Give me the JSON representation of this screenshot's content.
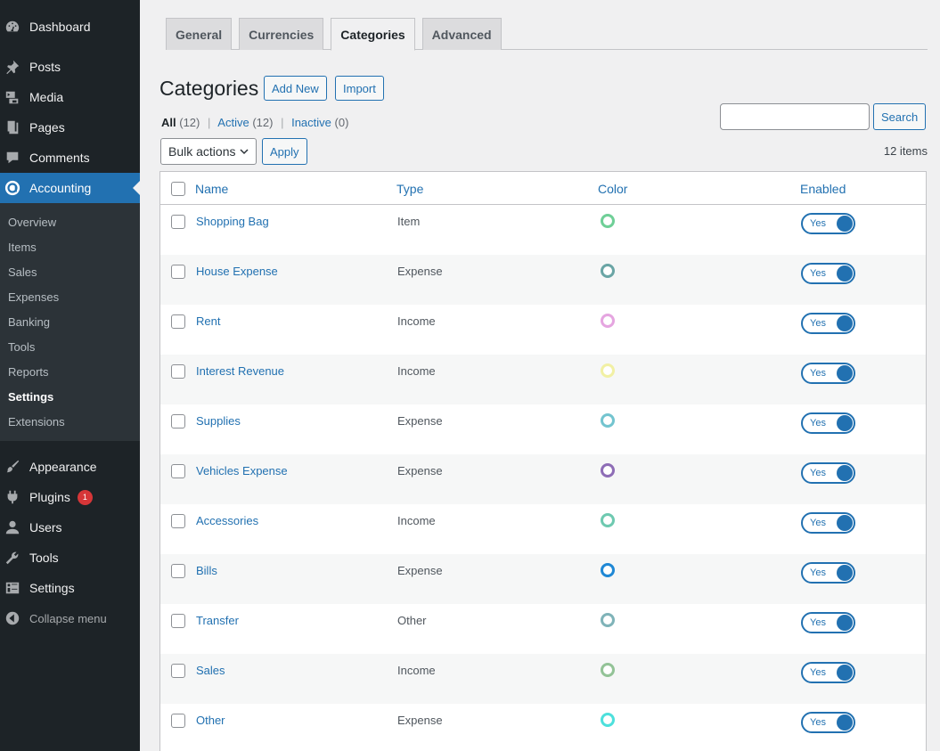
{
  "sidebar": {
    "top_items": [
      {
        "label": "Dashboard",
        "icon": "dashboard-icon"
      },
      {
        "label": "Posts",
        "icon": "pin-icon"
      },
      {
        "label": "Media",
        "icon": "media-icon"
      },
      {
        "label": "Pages",
        "icon": "pages-icon"
      },
      {
        "label": "Comments",
        "icon": "comment-icon"
      },
      {
        "label": "Accounting",
        "icon": "accounting-icon"
      }
    ],
    "submenu": [
      "Overview",
      "Items",
      "Sales",
      "Expenses",
      "Banking",
      "Tools",
      "Reports",
      "Settings",
      "Extensions"
    ],
    "bottom_items": [
      {
        "label": "Appearance",
        "icon": "brush-icon"
      },
      {
        "label": "Plugins",
        "icon": "plugin-icon",
        "badge": "1"
      },
      {
        "label": "Users",
        "icon": "user-icon"
      },
      {
        "label": "Tools",
        "icon": "wrench-icon"
      },
      {
        "label": "Settings",
        "icon": "settings-icon"
      },
      {
        "label": "Collapse menu",
        "icon": "collapse-icon"
      }
    ]
  },
  "tabs": [
    "General",
    "Currencies",
    "Categories",
    "Advanced"
  ],
  "header": {
    "title": "Categories",
    "add_new": "Add New",
    "import": "Import"
  },
  "filters": {
    "all_label": "All",
    "all_count": "(12)",
    "active_label": "Active",
    "active_count": "(12)",
    "inactive_label": "Inactive",
    "inactive_count": "(0)"
  },
  "search": {
    "button": "Search",
    "value": ""
  },
  "bulk": {
    "select": "Bulk actions",
    "apply": "Apply"
  },
  "items_count": "12 items",
  "table": {
    "columns": [
      "Name",
      "Type",
      "Color",
      "Enabled"
    ],
    "rows": [
      {
        "name": "Shopping Bag",
        "type": "Item",
        "color": "#6fcf97",
        "enabled": "Yes"
      },
      {
        "name": "House Expense",
        "type": "Expense",
        "color": "#6aa5a5",
        "enabled": "Yes"
      },
      {
        "name": "Rent",
        "type": "Income",
        "color": "#e5a5e0",
        "enabled": "Yes"
      },
      {
        "name": "Interest Revenue",
        "type": "Income",
        "color": "#f1f0a4",
        "enabled": "Yes"
      },
      {
        "name": "Supplies",
        "type": "Expense",
        "color": "#73c4cf",
        "enabled": "Yes"
      },
      {
        "name": "Vehicles Expense",
        "type": "Expense",
        "color": "#8e6db6",
        "enabled": "Yes"
      },
      {
        "name": "Accessories",
        "type": "Income",
        "color": "#6ec9b0",
        "enabled": "Yes"
      },
      {
        "name": "Bills",
        "type": "Expense",
        "color": "#1f88d5",
        "enabled": "Yes"
      },
      {
        "name": "Transfer",
        "type": "Other",
        "color": "#7fb3b8",
        "enabled": "Yes"
      },
      {
        "name": "Sales",
        "type": "Income",
        "color": "#93c397",
        "enabled": "Yes"
      },
      {
        "name": "Other",
        "type": "Expense",
        "color": "#4de0dc",
        "enabled": "Yes"
      }
    ]
  },
  "colors": {
    "accent": "#2271b1",
    "sidebar_bg": "#1d2327",
    "submenu_bg": "#2c3338",
    "badge": "#d63638"
  }
}
